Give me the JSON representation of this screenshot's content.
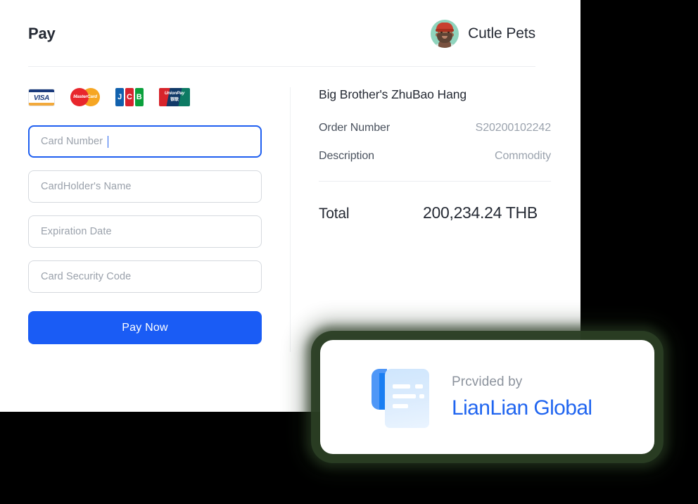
{
  "header": {
    "title": "Pay",
    "merchant_name": "Cutle Pets",
    "avatar_icon": "person-avatar-icon"
  },
  "payment_methods": [
    {
      "name": "visa-logo",
      "label": "VISA"
    },
    {
      "name": "mastercard-logo",
      "label": "MasterCard"
    },
    {
      "name": "jcb-logo",
      "letters": [
        "J",
        "C",
        "B"
      ]
    },
    {
      "name": "unionpay-logo",
      "label": "UnionPay",
      "label_cn": "银联"
    }
  ],
  "form": {
    "card_number": {
      "placeholder": "Card Number",
      "value": "",
      "focused": true
    },
    "cardholder_name": {
      "placeholder": "CardHolder's Name",
      "value": ""
    },
    "expiration_date": {
      "placeholder": "Expiration Date",
      "value": ""
    },
    "security_code": {
      "placeholder": "Card Security Code",
      "value": ""
    },
    "submit_label": "Pay Now"
  },
  "order": {
    "merchant": "Big Brother's ZhuBao Hang",
    "rows": [
      {
        "label": "Order Number",
        "value": "S20200102242"
      },
      {
        "label": "Description",
        "value": "Commodity"
      }
    ],
    "total_label": "Total",
    "total_value": "200,234.24 THB"
  },
  "provider": {
    "prefix": "Prcvided by",
    "name": "LianLian Global",
    "icon": "document-receipt-icon"
  },
  "colors": {
    "accent_blue": "#1a5cf5",
    "focus_blue": "#1f5ff0",
    "provider_blue": "#2065f0",
    "text_dark": "#252a34",
    "text_muted": "#9aa2ad",
    "shadow_green": "#2a3e24",
    "page_background": "#000000"
  }
}
